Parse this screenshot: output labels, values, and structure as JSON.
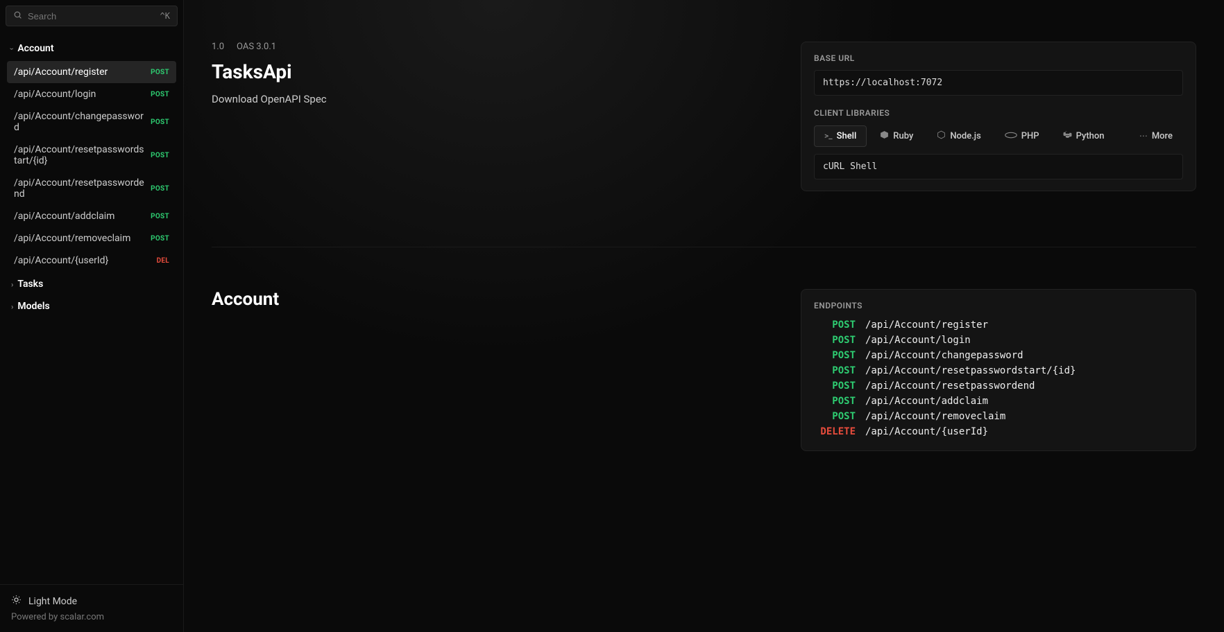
{
  "search": {
    "placeholder": "Search",
    "shortcut": "^K"
  },
  "sidebar": {
    "sections": [
      {
        "label": "Account",
        "open": true
      },
      {
        "label": "Tasks",
        "open": false
      },
      {
        "label": "Models",
        "open": false
      }
    ],
    "accountItems": [
      {
        "path": "/api/Account/register",
        "method": "POST",
        "active": true
      },
      {
        "path": "/api/Account/login",
        "method": "POST",
        "active": false
      },
      {
        "path": "/api/Account/changepassword",
        "method": "POST",
        "active": false
      },
      {
        "path": "/api/Account/resetpasswordstart/{id}",
        "method": "POST",
        "active": false
      },
      {
        "path": "/api/Account/resetpasswordend",
        "method": "POST",
        "active": false
      },
      {
        "path": "/api/Account/addclaim",
        "method": "POST",
        "active": false
      },
      {
        "path": "/api/Account/removeclaim",
        "method": "POST",
        "active": false
      },
      {
        "path": "/api/Account/{userId}",
        "method": "DEL",
        "active": false
      }
    ],
    "footer": {
      "theme": "Light Mode",
      "powered": "Powered by scalar.com"
    }
  },
  "hero": {
    "version": "1.0",
    "oas": "OAS 3.0.1",
    "title": "TasksApi",
    "download": "Download OpenAPI Spec",
    "baseUrlLabel": "BASE URL",
    "baseUrl": "https://localhost:7072",
    "clientLibLabel": "CLIENT LIBRARIES",
    "libs": [
      {
        "label": "Shell",
        "active": true
      },
      {
        "label": "Ruby",
        "active": false
      },
      {
        "label": "Node.js",
        "active": false
      },
      {
        "label": "PHP",
        "active": false
      },
      {
        "label": "Python",
        "active": false
      }
    ],
    "moreLabel": "More",
    "libSub": "cURL Shell"
  },
  "accountSection": {
    "title": "Account",
    "endpointsLabel": "ENDPOINTS",
    "endpoints": [
      {
        "method": "POST",
        "path": "/api/Account/register"
      },
      {
        "method": "POST",
        "path": "/api/Account/login"
      },
      {
        "method": "POST",
        "path": "/api/Account/changepassword"
      },
      {
        "method": "POST",
        "path": "/api/Account/resetpasswordstart/{id}"
      },
      {
        "method": "POST",
        "path": "/api/Account/resetpasswordend"
      },
      {
        "method": "POST",
        "path": "/api/Account/addclaim"
      },
      {
        "method": "POST",
        "path": "/api/Account/removeclaim"
      },
      {
        "method": "DELETE",
        "path": "/api/Account/{userId}"
      }
    ]
  }
}
